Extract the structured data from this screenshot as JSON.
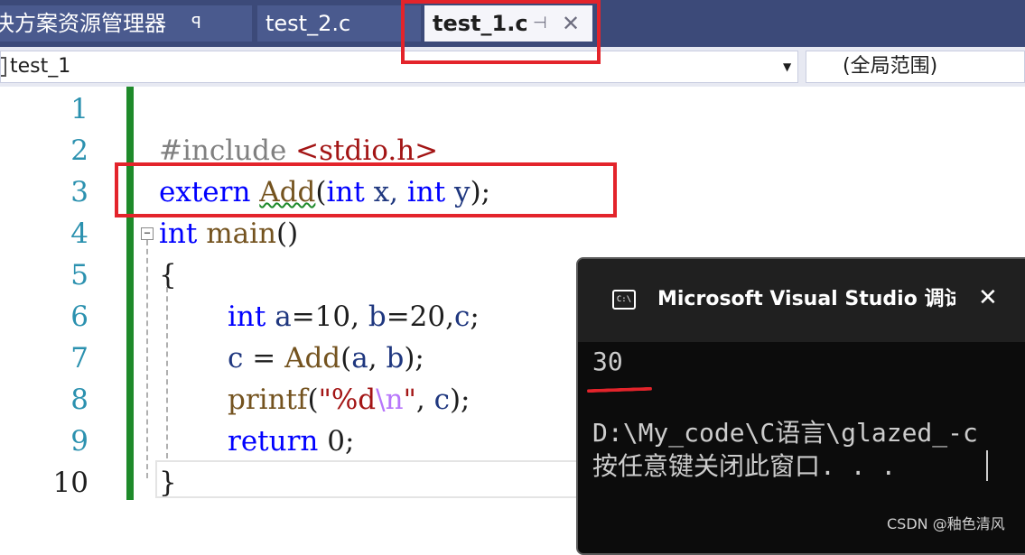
{
  "tabs": {
    "solution_explorer": {
      "label": "决方案资源管理器",
      "pin_icon": "ꟼ"
    },
    "test_2": {
      "label": "test_2.c"
    },
    "test_1": {
      "label": "test_1.c",
      "pin_icon": "⊣",
      "close_icon": "✕",
      "active": true
    }
  },
  "navbar": {
    "file_combo": "test_1",
    "scope_combo": "(全局范围)"
  },
  "editor": {
    "line_numbers": [
      "1",
      "2",
      "3",
      "4",
      "5",
      "6",
      "7",
      "8",
      "9",
      "10"
    ],
    "current_line": "10",
    "tokens": {
      "l2_pp": "#include ",
      "l2_inc": "<stdio.h>",
      "l3_extern": "extern",
      "l3_add": "Add",
      "l3_open": "(",
      "l3_int1": "int",
      "l3_x": " x, ",
      "l3_int2": "int",
      "l3_y": " y",
      "l3_close": ");",
      "l4_int": "int",
      "l4_main": " main",
      "l4_parens": "()",
      "l5_brace": "{",
      "l6_int": "int",
      "l6_a": " a",
      "l6_rest1": "=10, ",
      "l6_b": "b",
      "l6_rest2": "=20,",
      "l6_c": "c",
      "l6_semi": ";",
      "l7_c": "c",
      "l7_eq": " = ",
      "l7_add": "Add",
      "l7_open": "(",
      "l7_a": "a",
      "l7_comma": ", ",
      "l7_b": "b",
      "l7_close": ");",
      "l8_printf": "printf",
      "l8_open": "(",
      "l8_str1": "\"%d",
      "l8_esc": "\\n",
      "l8_str2": "\"",
      "l8_comma": ", ",
      "l8_c": "c",
      "l8_close": ");",
      "l9_return": "return",
      "l9_rest": " 0;",
      "l10_brace": "}"
    }
  },
  "console": {
    "title": "Microsoft Visual Studio 调试控制台",
    "icon_text": "C:\\",
    "close_icon": "✕",
    "output_value": "30",
    "path_line": "D:\\My_code\\C语言\\glazed_-c",
    "exit_prompt": "按任意键关闭此窗口. . ."
  },
  "watermark": "CSDN @釉色清风",
  "colors": {
    "highlight_box": "#e3242b",
    "keyword": "#0000ff",
    "change_bar": "#1e8a2a",
    "tab_strip": "#3c4a79"
  }
}
